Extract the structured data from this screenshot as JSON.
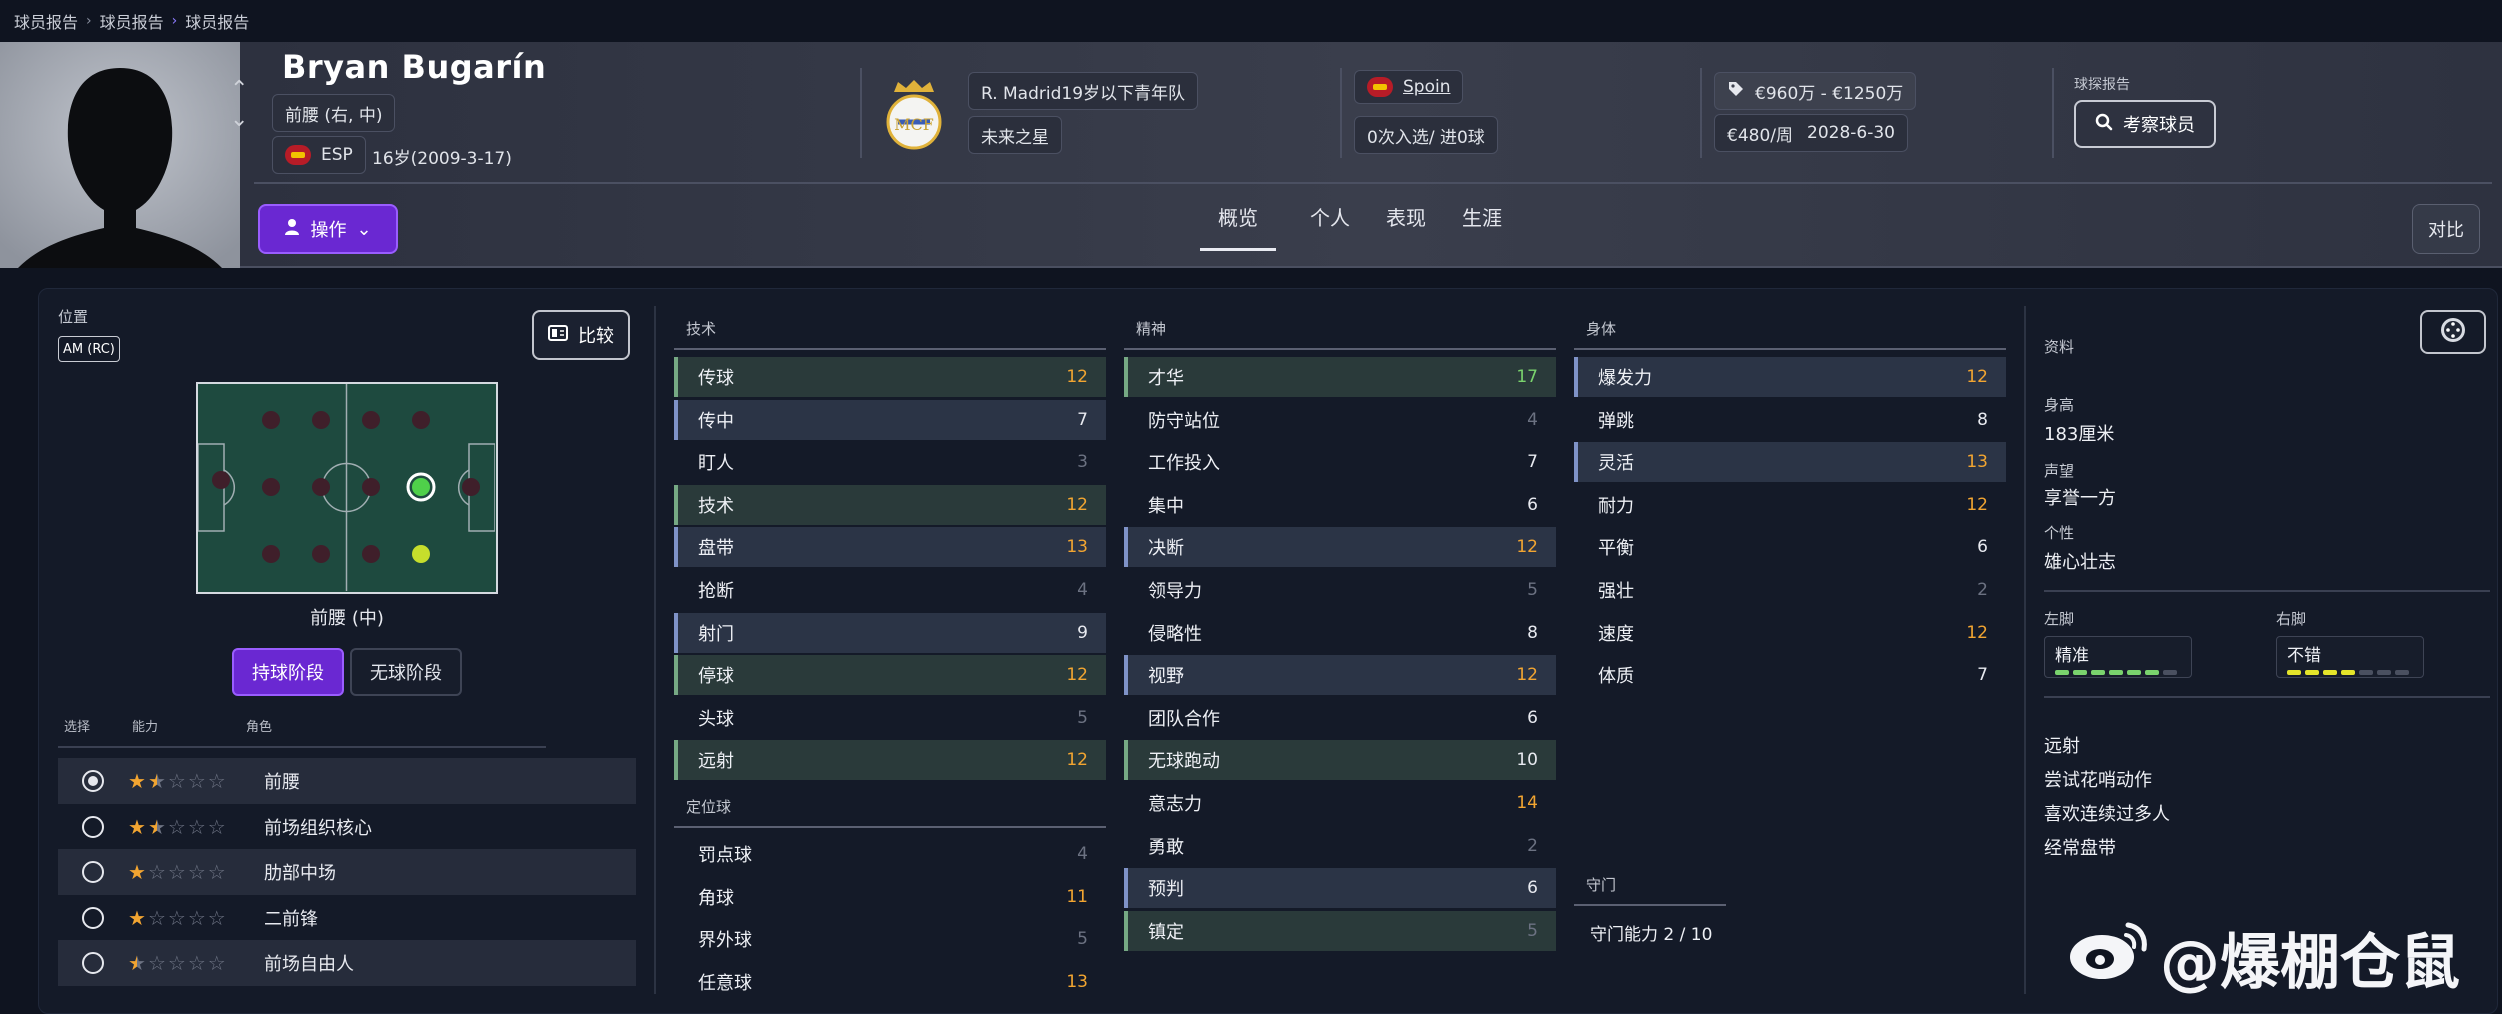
{
  "breadcrumb": [
    "球员报告",
    "球员报告",
    "球员报告"
  ],
  "player": {
    "name": "Bryan Bugarín",
    "position": "前腰 (右, 中)",
    "nation": "ESP",
    "age": "16岁(2009-3-17)",
    "club": "R. Madrid19岁以下青年队",
    "status": "未来之星",
    "nation_link": "Spoin",
    "caps": "0次入选/ 进0球",
    "value": "€960万 - €1250万",
    "wage": "€480/周",
    "contract": "2028-6-30"
  },
  "header": {
    "action_label": "操作",
    "scout_label": "球探报告",
    "scout_button": "考察球员",
    "compare_label": "对比",
    "tabs": [
      "概览",
      "个人",
      "表现",
      "生涯"
    ]
  },
  "left": {
    "position_label": "位置",
    "position_chip": "AM (RC)",
    "compare_button": "比较",
    "position_name": "前腰 (中)",
    "phase_on": "持球阶段",
    "phase_off": "无球阶段",
    "headers": [
      "选择",
      "能力",
      "角色"
    ],
    "roles": [
      {
        "name": "前腰",
        "stars": 1.5,
        "selected": true
      },
      {
        "name": "前场组织核心",
        "stars": 1.5,
        "selected": false
      },
      {
        "name": "肋部中场",
        "stars": 1,
        "selected": false
      },
      {
        "name": "二前锋",
        "stars": 1,
        "selected": false
      },
      {
        "name": "前场自由人",
        "stars": 0.5,
        "selected": false
      }
    ]
  },
  "technical": {
    "title": "技术",
    "items": [
      {
        "name": "传球",
        "value": "12",
        "style": "green",
        "color": "orange"
      },
      {
        "name": "传中",
        "value": "7",
        "style": "blue",
        "color": "white"
      },
      {
        "name": "盯人",
        "value": "3",
        "style": "",
        "color": "grey"
      },
      {
        "name": "技术",
        "value": "12",
        "style": "green",
        "color": "orange"
      },
      {
        "name": "盘带",
        "value": "13",
        "style": "blue",
        "color": "orange"
      },
      {
        "name": "抢断",
        "value": "4",
        "style": "",
        "color": "grey"
      },
      {
        "name": "射门",
        "value": "9",
        "style": "blue",
        "color": "white"
      },
      {
        "name": "停球",
        "value": "12",
        "style": "green",
        "color": "orange"
      },
      {
        "name": "头球",
        "value": "5",
        "style": "",
        "color": "grey"
      },
      {
        "name": "远射",
        "value": "12",
        "style": "green",
        "color": "orange"
      }
    ],
    "setpiece_title": "定位球",
    "setpieces": [
      {
        "name": "罚点球",
        "value": "4",
        "style": "",
        "color": "grey"
      },
      {
        "name": "角球",
        "value": "11",
        "style": "",
        "color": "orange"
      },
      {
        "name": "界外球",
        "value": "5",
        "style": "",
        "color": "grey"
      },
      {
        "name": "任意球",
        "value": "13",
        "style": "",
        "color": "orange"
      }
    ]
  },
  "mental": {
    "title": "精神",
    "items": [
      {
        "name": "才华",
        "value": "17",
        "style": "green",
        "color": "green"
      },
      {
        "name": "防守站位",
        "value": "4",
        "style": "",
        "color": "grey"
      },
      {
        "name": "工作投入",
        "value": "7",
        "style": "",
        "color": "white"
      },
      {
        "name": "集中",
        "value": "6",
        "style": "",
        "color": "white"
      },
      {
        "name": "决断",
        "value": "12",
        "style": "blue",
        "color": "orange"
      },
      {
        "name": "领导力",
        "value": "5",
        "style": "",
        "color": "grey"
      },
      {
        "name": "侵略性",
        "value": "8",
        "style": "",
        "color": "white"
      },
      {
        "name": "视野",
        "value": "12",
        "style": "blue",
        "color": "orange"
      },
      {
        "name": "团队合作",
        "value": "6",
        "style": "",
        "color": "white"
      },
      {
        "name": "无球跑动",
        "value": "10",
        "style": "green",
        "color": "white"
      },
      {
        "name": "意志力",
        "value": "14",
        "style": "",
        "color": "orange"
      },
      {
        "name": "勇敢",
        "value": "2",
        "style": "",
        "color": "grey"
      },
      {
        "name": "预判",
        "value": "6",
        "style": "blue",
        "color": "white"
      },
      {
        "name": "镇定",
        "value": "5",
        "style": "green",
        "color": "grey"
      }
    ]
  },
  "physical": {
    "title": "身体",
    "items": [
      {
        "name": "爆发力",
        "value": "12",
        "style": "blue",
        "color": "orange"
      },
      {
        "name": "弹跳",
        "value": "8",
        "style": "",
        "color": "white"
      },
      {
        "name": "灵活",
        "value": "13",
        "style": "blue",
        "color": "orange"
      },
      {
        "name": "耐力",
        "value": "12",
        "style": "",
        "color": "orange"
      },
      {
        "name": "平衡",
        "value": "6",
        "style": "",
        "color": "white"
      },
      {
        "name": "强壮",
        "value": "2",
        "style": "",
        "color": "grey"
      },
      {
        "name": "速度",
        "value": "12",
        "style": "",
        "color": "orange"
      },
      {
        "name": "体质",
        "value": "7",
        "style": "",
        "color": "white"
      }
    ],
    "gk_title": "守门",
    "gk_text": "守门能力 2 / 10"
  },
  "info": {
    "title": "资料",
    "height_label": "身高",
    "height": "183厘米",
    "rep_label": "声望",
    "rep": "享誉一方",
    "personality_label": "个性",
    "personality": "雄心壮志",
    "left_foot_label": "左脚",
    "left_foot": "精准",
    "left_foot_level": 6,
    "right_foot_label": "右脚",
    "right_foot": "不错",
    "right_foot_level": 4,
    "traits": [
      "远射",
      "尝试花哨动作",
      "喜欢连续过多人",
      "经常盘带"
    ]
  },
  "watermark": "@爆棚仓鼠",
  "colors": {
    "accent": "#6a28d2",
    "orange": "#f2a531",
    "green": "#7ad36d"
  }
}
